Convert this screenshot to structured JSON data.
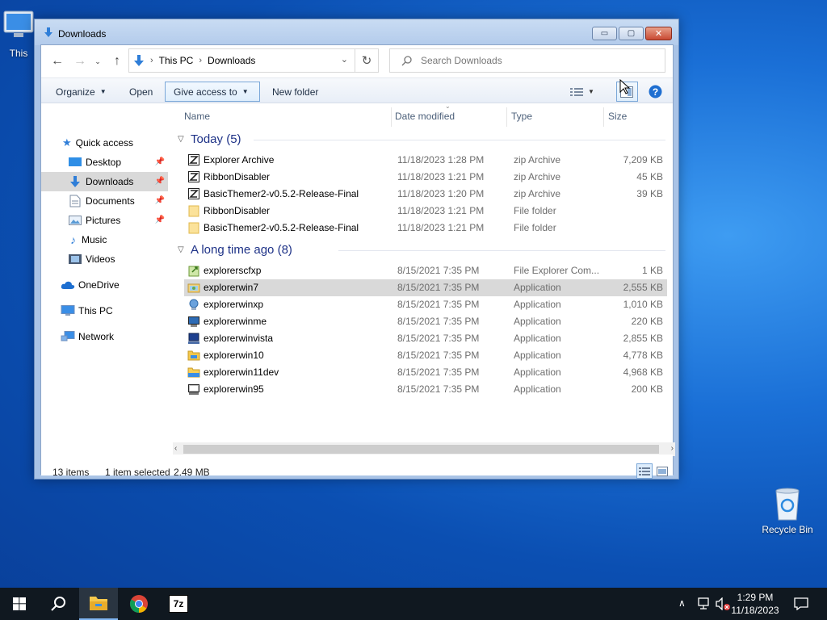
{
  "desktop": {
    "this_pc_label": "This",
    "recycle_bin_label": "Recycle Bin"
  },
  "window": {
    "title": "Downloads",
    "min_glyph": "▭",
    "max_glyph": "▢",
    "close_glyph": "✕"
  },
  "address": {
    "crumbs": [
      "This PC",
      "Downloads"
    ],
    "search_placeholder": "Search Downloads"
  },
  "toolbar": {
    "organize": "Organize",
    "open": "Open",
    "give_access": "Give access to",
    "new_folder": "New folder"
  },
  "nav": {
    "quick_access": "Quick access",
    "desktop": "Desktop",
    "downloads": "Downloads",
    "documents": "Documents",
    "pictures": "Pictures",
    "music": "Music",
    "videos": "Videos",
    "onedrive": "OneDrive",
    "this_pc": "This PC",
    "network": "Network"
  },
  "columns": {
    "name": "Name",
    "date": "Date modified",
    "type": "Type",
    "size": "Size"
  },
  "groups": [
    {
      "header": "Today (5)",
      "rows": [
        {
          "name": "Explorer Archive",
          "date": "11/18/2023 1:28 PM",
          "type": "zip Archive",
          "size": "7,209 KB",
          "icon": "zip-icon"
        },
        {
          "name": "RibbonDisabler",
          "date": "11/18/2023 1:21 PM",
          "type": "zip Archive",
          "size": "45 KB",
          "icon": "zip-icon"
        },
        {
          "name": "BasicThemer2-v0.5.2-Release-Final",
          "date": "11/18/2023 1:20 PM",
          "type": "zip Archive",
          "size": "39 KB",
          "icon": "zip-icon"
        },
        {
          "name": "RibbonDisabler",
          "date": "11/18/2023 1:21 PM",
          "type": "File folder",
          "size": "",
          "icon": "folder-icon"
        },
        {
          "name": "BasicThemer2-v0.5.2-Release-Final",
          "date": "11/18/2023 1:21 PM",
          "type": "File folder",
          "size": "",
          "icon": "folder-icon"
        }
      ]
    },
    {
      "header": "A long time ago (8)",
      "rows": [
        {
          "name": "explorerscfxp",
          "date": "8/15/2021 7:35 PM",
          "type": "File Explorer Com...",
          "size": "1 KB",
          "icon": "scf-icon"
        },
        {
          "name": "explorerwin7",
          "date": "8/15/2021 7:35 PM",
          "type": "Application",
          "size": "2,555 KB",
          "icon": "app-win7-icon"
        },
        {
          "name": "explorerwinxp",
          "date": "8/15/2021 7:35 PM",
          "type": "Application",
          "size": "1,010 KB",
          "icon": "app-winxp-icon"
        },
        {
          "name": "explorerwinme",
          "date": "8/15/2021 7:35 PM",
          "type": "Application",
          "size": "220 KB",
          "icon": "app-winme-icon"
        },
        {
          "name": "explorerwinvista",
          "date": "8/15/2021 7:35 PM",
          "type": "Application",
          "size": "2,855 KB",
          "icon": "app-vista-icon"
        },
        {
          "name": "explorerwin10",
          "date": "8/15/2021 7:35 PM",
          "type": "Application",
          "size": "4,778 KB",
          "icon": "app-win10-icon"
        },
        {
          "name": "explorerwin11dev",
          "date": "8/15/2021 7:35 PM",
          "type": "Application",
          "size": "4,968 KB",
          "icon": "app-win11-icon"
        },
        {
          "name": "explorerwin95",
          "date": "8/15/2021 7:35 PM",
          "type": "Application",
          "size": "200 KB",
          "icon": "app-win95-icon"
        }
      ]
    }
  ],
  "selected_row": "explorerwin7",
  "status": {
    "item_count": "13 items",
    "selected": "1 item selected",
    "selected_size": "2.49 MB"
  },
  "taskbar": {
    "time": "1:29 PM",
    "date": "11/18/2023",
    "sevenzip_label": "7z"
  },
  "colors": {
    "accent": "#0078d7",
    "selection": "#d9d9d9",
    "group_header": "#1e3287"
  }
}
